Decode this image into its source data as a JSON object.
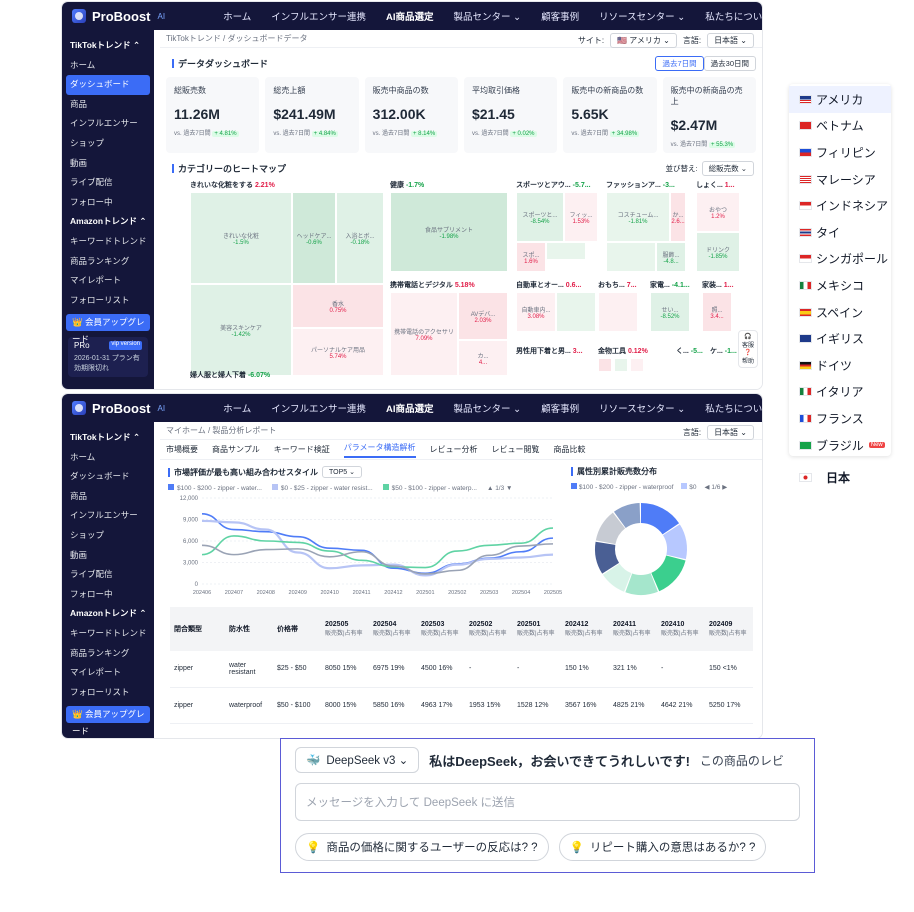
{
  "brand": {
    "name": "ProBoost",
    "sup": "AI"
  },
  "topnav": [
    "ホーム",
    "インフルエンサー連携",
    "AI商品選定",
    "製品センター ⌄",
    "顧客事例",
    "リソースセンター ⌄",
    "私たちについて"
  ],
  "sidebar1": [
    "TikTokトレンド ⌃",
    "ホーム",
    "ダッシュボード",
    "商品",
    "インフルエンサー",
    "ショップ",
    "動画",
    "ライブ配信",
    "フォロー中",
    "Amazonトレンド ⌃",
    "キーワードトレンド",
    "商品ランキング",
    "マイレポート",
    "フォローリスト"
  ],
  "sidebar2": [
    "TikTokトレンド ⌃",
    "ホーム",
    "ダッシュボード",
    "商品",
    "インフルエンサー",
    "ショップ",
    "動画",
    "ライブ配信",
    "フォロー中",
    "Amazonトレンド ⌃",
    "キーワードトレンド",
    "商品ランキング",
    "マイレポート",
    "フォローリスト"
  ],
  "upgrade": "会員アップグレード",
  "pro": {
    "title": "PRo",
    "tag": "vip version",
    "date": "2026-01-31",
    "note": "プラン有効期限切れ"
  },
  "dash": {
    "crumb": "TikTokトレンド / ダッシュボードデータ",
    "site_label": "サイト:",
    "site": "アメリカ",
    "lang_label": "言語:",
    "lang": "日本語",
    "section": "データダッシュボード",
    "period1": "過去7日間",
    "period2": "過去30日間",
    "cards": [
      {
        "t": "総販売数",
        "v": "11.26M",
        "s": "vs. 過去7日間",
        "d": "+ 4.81%"
      },
      {
        "t": "総売上額",
        "v": "$241.49M",
        "s": "vs. 過去7日間",
        "d": "+ 4.84%"
      },
      {
        "t": "販売中商品の数",
        "v": "312.00K",
        "s": "vs. 過去7日間",
        "d": "+ 8.14%"
      },
      {
        "t": "平均取引価格",
        "v": "$21.45",
        "s": "vs. 過去7日間",
        "d": "+ 0.02%"
      },
      {
        "t": "販売中の新商品の数",
        "v": "5.65K",
        "s": "vs. 過去7日間",
        "d": "+ 34.98%"
      },
      {
        "t": "販売中の新商品の売上",
        "v": "$2.47M",
        "s": "vs. 過去7日間",
        "d": "+ 55.3%"
      }
    ],
    "heat_title": "カテゴリーのヒートマップ",
    "sort_label": "並び替え:",
    "sort": "総販売数",
    "cat1": "きれいな化粧をする",
    "cat1v": "2.21%",
    "cat2": "健康",
    "cat2v": "-1.7%",
    "cat3": "スポーツとアウ...",
    "cat3v": "-5.7...",
    "cat4": "ファッションア...",
    "cat4v": "-3...",
    "cat5": "しょく...",
    "cat5v": "1...",
    "cat6": "携帯電話とデジタル",
    "cat6v": "5.18%",
    "cat7": "自動車とオー...",
    "cat7v": "0.6...",
    "cat8": "おもち...",
    "cat8v": "7...",
    "cat9": "家電...",
    "cat9v": "-4.1...",
    "cat10": "家装...",
    "cat10v": "1...",
    "cat11": "男性用下着と男...",
    "cat11v": "3...",
    "cat12": "金物工具",
    "cat12v": "0.12%",
    "cat13": "く...",
    "cat13v": "-5...",
    "cat14": "ケ...",
    "cat14v": "-1...",
    "cat15": "婦人服と婦人下着",
    "cat15v": "-6.07%",
    "tiles": [
      {
        "n": "きれいな化粧",
        "v": "-1.5%"
      },
      {
        "n": "ヘッドケア...",
        "v": "-0.6%"
      },
      {
        "n": "入浴とボ...",
        "v": "-0.18%"
      },
      {
        "n": "美容スキンケア",
        "v": "-1.42%"
      },
      {
        "n": "香水",
        "v": "0.75%"
      },
      {
        "n": "パーソナルケア用品",
        "v": "5.74%"
      },
      {
        "n": "食品サプリメント",
        "v": "-1.98%"
      },
      {
        "n": "携帯電話のアクセサリ",
        "v": "7.09%"
      },
      {
        "n": "AVデバ...",
        "v": "2.03%"
      },
      {
        "n": "カ...",
        "v": "4..."
      },
      {
        "n": "スポーツと...",
        "v": "-8.54%"
      },
      {
        "n": "フィッ...",
        "v": "1.53%"
      },
      {
        "n": "スポ...",
        "v": "1.6%"
      },
      {
        "n": "コスチューム...",
        "v": "-1.81%"
      },
      {
        "n": "か...",
        "v": "2.6..."
      },
      {
        "n": "服飾...",
        "v": "-4.8..."
      },
      {
        "n": "おやつ",
        "v": "1.2%"
      },
      {
        "n": "ドリンク",
        "v": "-1.85%"
      },
      {
        "n": "自動車内...",
        "v": "3.08%"
      },
      {
        "n": "せい...",
        "v": "-8.52%"
      },
      {
        "n": "照...",
        "v": "3.4..."
      }
    ],
    "help1": "客服",
    "help2": "帮助"
  },
  "report": {
    "crumb": "マイホーム / 製品分析レポート",
    "lang_label": "言語:",
    "lang": "日本語",
    "tabs": [
      "市場概要",
      "商品サンプル",
      "キーワード検証",
      "パラメータ構造解析",
      "レビュー分析",
      "レビュー閲覧",
      "商品比較"
    ],
    "chart_title": "市場評価が最も高い組み合わせスタイル",
    "top": "TOP5 ⌄",
    "donut_title": "属性別累計販売数分布",
    "legend": [
      "$100 - $200 - zipper - water...",
      "$0 - $25 - zipper - water resist...",
      "$50 - $100 - zipper - waterp..."
    ],
    "legend_page": "1/3",
    "donut_legend": [
      "$100 - $200 - zipper - waterproof",
      "$0"
    ],
    "donut_page": "1/6",
    "table": {
      "head": [
        "閉合類型",
        "防水性",
        "价格帯",
        "202505",
        "202504",
        "202503",
        "202502",
        "202501",
        "202412",
        "202411",
        "202410",
        "202409"
      ],
      "sub": "販売数|占有率",
      "rows": [
        [
          "zipper",
          "water resistant",
          "$25 - $50",
          "8050 15%",
          "6975 19%",
          "4500 16%",
          "-",
          "-",
          "150 1%",
          "321 1%",
          "-",
          "150 <1%"
        ],
        [
          "zipper",
          "waterproof",
          "$50 - $100",
          "8000 15%",
          "5850 16%",
          "4963 17%",
          "1953 15%",
          "1528 12%",
          "3567 16%",
          "4825 21%",
          "4642 21%",
          "5250 17%"
        ]
      ]
    }
  },
  "chart_data": {
    "type": "line",
    "x": [
      "202406",
      "202407",
      "202408",
      "202409",
      "202410",
      "202411",
      "202412",
      "202501",
      "202502",
      "202503",
      "202504",
      "202505"
    ],
    "ylim": [
      0,
      12000
    ],
    "yticks": [
      "12,000",
      "9,000",
      "6,000",
      "3,000",
      "0"
    ],
    "series": [
      {
        "name": "$100 - $200 - zipper - water...",
        "color": "#4f7cf7",
        "values": [
          9800,
          7600,
          7300,
          6600,
          5000,
          4700,
          2200,
          1500,
          2800,
          3600,
          4500,
          6400
        ]
      },
      {
        "name": "$0 - $25 - zipper - water resist...",
        "color": "#b7c4f5",
        "values": [
          8800,
          8600,
          7600,
          4400,
          2200,
          2600,
          2700,
          1200,
          2700,
          3500,
          3700,
          4100
        ]
      },
      {
        "name": "$50 - $100 - zipper - waterp...",
        "color": "#5fd3a4",
        "values": [
          4100,
          6700,
          6000,
          5800,
          4600,
          3300,
          2400,
          2300,
          4600,
          5400,
          5700,
          7800
        ]
      },
      {
        "name": "",
        "color": "#9aa3b5",
        "values": [
          5400,
          4100,
          4800,
          4900,
          3800,
          4500,
          2500,
          1400,
          1900,
          4000,
          5300,
          5600
        ]
      }
    ]
  },
  "donut": [
    {
      "c": "#4f7cf7",
      "v": 16
    },
    {
      "c": "#b7c8ff",
      "v": 13
    },
    {
      "c": "#3bcf8e",
      "v": 15
    },
    {
      "c": "#a5e6cc",
      "v": 12
    },
    {
      "c": "#d8f3e8",
      "v": 10
    },
    {
      "c": "#4a5f94",
      "v": 12
    },
    {
      "c": "#c7cbd3",
      "v": 12
    },
    {
      "c": "#8aa0c8",
      "v": 10
    }
  ],
  "languages": [
    {
      "n": "アメリカ",
      "f": "us"
    },
    {
      "n": "ベトナム",
      "f": "vn"
    },
    {
      "n": "フィリピン",
      "f": "ph"
    },
    {
      "n": "マレーシア",
      "f": "my"
    },
    {
      "n": "インドネシア",
      "f": "id"
    },
    {
      "n": "タイ",
      "f": "th"
    },
    {
      "n": "シンガポール",
      "f": "sg"
    },
    {
      "n": "メキシコ",
      "f": "mx"
    },
    {
      "n": "スペイン",
      "f": "es"
    },
    {
      "n": "イギリス",
      "f": "gb"
    },
    {
      "n": "ドイツ",
      "f": "de"
    },
    {
      "n": "イタリア",
      "f": "it"
    },
    {
      "n": "フランス",
      "f": "fr"
    },
    {
      "n": "ブラジル",
      "f": "br",
      "new": "New"
    },
    {
      "n": "日本",
      "f": "jp"
    }
  ],
  "deepseek": {
    "model": "DeepSeek v3 ⌄",
    "greet": "私はDeepSeek，お会いできてうれしいです!",
    "greet2": "この商品のレビ",
    "placeholder": "メッセージを入力して DeepSeek に送信",
    "q1": "商品の価格に関するユーザーの反応は? ?",
    "q2": "リピート購入の意思はあるか? ?"
  }
}
